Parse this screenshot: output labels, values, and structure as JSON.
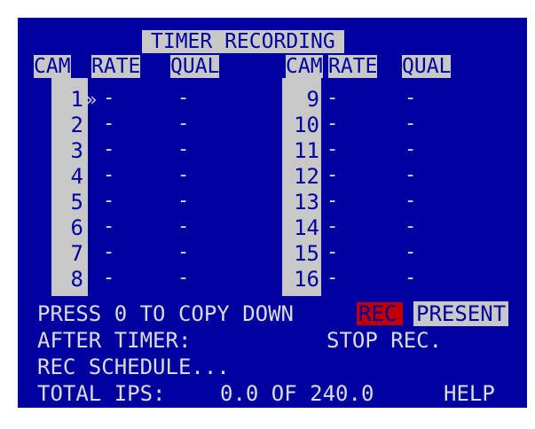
{
  "title": "TIMER RECORDING",
  "headers": {
    "left_cam": "CAM",
    "left_rate": "RATE",
    "left_qual": "QUAL",
    "right_cam": "CAM",
    "right_rate": "RATE",
    "right_qual": "QUAL"
  },
  "cursor": "»",
  "rows_left": [
    {
      "cam": "1",
      "rate": "-",
      "qual": "-"
    },
    {
      "cam": "2",
      "rate": "-",
      "qual": "-"
    },
    {
      "cam": "3",
      "rate": "-",
      "qual": "-"
    },
    {
      "cam": "4",
      "rate": "-",
      "qual": "-"
    },
    {
      "cam": "5",
      "rate": "-",
      "qual": "-"
    },
    {
      "cam": "6",
      "rate": "-",
      "qual": "-"
    },
    {
      "cam": "7",
      "rate": "-",
      "qual": "-"
    },
    {
      "cam": "8",
      "rate": "-",
      "qual": "-"
    }
  ],
  "rows_right": [
    {
      "cam": "9",
      "rate": "-",
      "qual": "-"
    },
    {
      "cam": "10",
      "rate": "-",
      "qual": "-"
    },
    {
      "cam": "11",
      "rate": "-",
      "qual": "-"
    },
    {
      "cam": "12",
      "rate": "-",
      "qual": "-"
    },
    {
      "cam": "13",
      "rate": "-",
      "qual": "-"
    },
    {
      "cam": "14",
      "rate": "-",
      "qual": "-"
    },
    {
      "cam": "15",
      "rate": "-",
      "qual": "-"
    },
    {
      "cam": "16",
      "rate": "-",
      "qual": "-"
    }
  ],
  "bottom": {
    "copy_prefix": "PRESS 0 TO COPY DOWN",
    "rec_label": "REC",
    "present_label": "PRESENT",
    "after_timer_label": "AFTER TIMER:",
    "after_timer_value": "STOP REC.",
    "rec_schedule": "REC SCHEDULE...",
    "total_ips_label": "TOTAL IPS:",
    "total_ips_value": "0.0 OF 240.0",
    "help": "HELP"
  },
  "colors": {
    "background": "#0000a0",
    "highlight": "#c8c8c8",
    "text": "#dcdcdc",
    "rec": "#c00000"
  }
}
